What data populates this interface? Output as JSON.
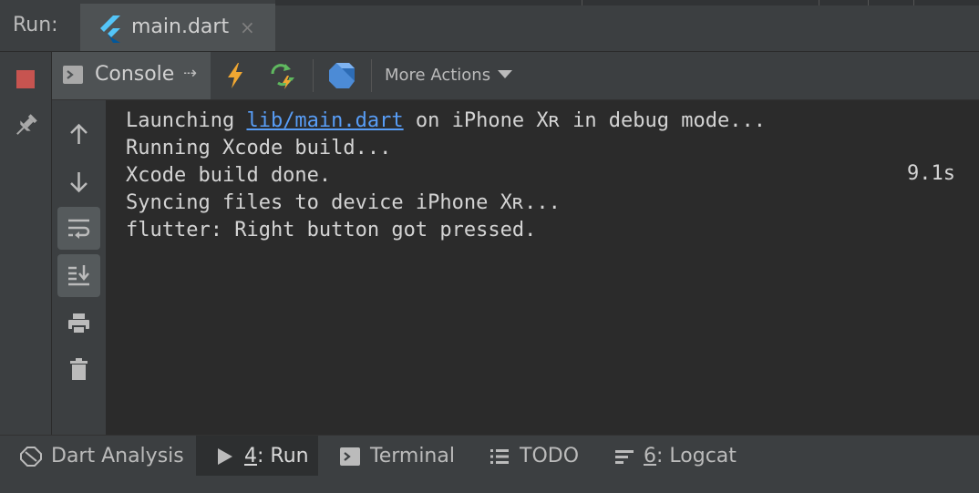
{
  "run_panel": {
    "label": "Run:",
    "tab": {
      "name": "main.dart",
      "close": "×"
    }
  },
  "toolbar": {
    "console_label": "Console",
    "console_arrow": "⇢",
    "more_actions": "More Actions"
  },
  "console": {
    "lines": [
      {
        "pre": "Launching ",
        "link": "lib/main.dart",
        "post": " on iPhone Xʀ in debug mode..."
      },
      {
        "text": "Running Xcode build..."
      },
      {
        "text": "Xcode build done."
      },
      {
        "text": "Syncing files to device iPhone Xʀ..."
      },
      {
        "text": "flutter: Right button got pressed."
      }
    ],
    "timing": "9.1s"
  },
  "bottom_tabs": {
    "dart_analysis": "Dart Analysis",
    "run_num": "4",
    "run_rest": ": Run",
    "terminal": "Terminal",
    "todo": "TODO",
    "logcat_num": "6",
    "logcat_rest": ": Logcat"
  },
  "colors": {
    "stop": "#c75450",
    "lightning": "#f0a732",
    "reload": "#5fb85f",
    "dart": "#4c8bd6",
    "link": "#589df6"
  }
}
